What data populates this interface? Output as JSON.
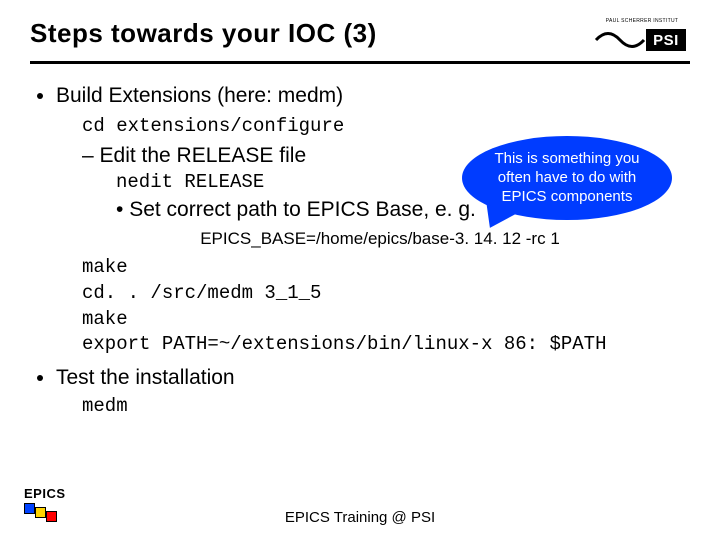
{
  "header": {
    "title": "Steps towards your IOC (3)",
    "logo_top": "PAUL SCHERRER INSTITUT",
    "logo_text": "PSI"
  },
  "content": {
    "bullet1": "Build Extensions (here: medm)",
    "cmd1": "cd extensions/configure",
    "dash1": "– Edit the RELEASE file",
    "cmd2": "nedit RELEASE",
    "bullet2": "Set correct path to EPICS Base, e. g.",
    "example": "EPICS_BASE=/home/epics/base-3. 14. 12 -rc 1",
    "block": [
      "make",
      "cd. . /src/medm 3_1_5",
      "make",
      "export PATH=~/extensions/bin/linux-x 86: $PATH"
    ],
    "bullet3": "Test the installation",
    "cmd3": "medm"
  },
  "callout": {
    "line1": "This is something you",
    "line2": "often have to do with",
    "line3": "EPICS components"
  },
  "footer": {
    "epics": "EPICS",
    "center": "EPICS Training @ PSI"
  }
}
